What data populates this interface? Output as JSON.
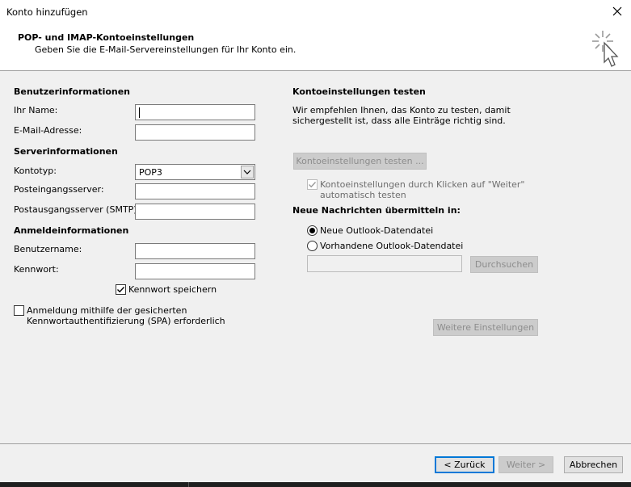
{
  "window": {
    "title": "Konto hinzufügen",
    "close_icon": "close-icon"
  },
  "header": {
    "title": "POP- und IMAP-Kontoeinstellungen",
    "subtitle": "Geben Sie die E-Mail-Servereinstellungen für Ihr Konto ein.",
    "icon": "sparkle-cursor-icon"
  },
  "left": {
    "user_section": "Benutzerinformationen",
    "name_label": "Ihr Name:",
    "name_value": "",
    "email_label": "E-Mail-Adresse:",
    "email_value": "",
    "server_section": "Serverinformationen",
    "account_type_label": "Kontotyp:",
    "account_type_value": "POP3",
    "incoming_label": "Posteingangsserver:",
    "incoming_value": "",
    "outgoing_label": "Postausgangsserver (SMTP):",
    "outgoing_value": "",
    "login_section": "Anmeldeinformationen",
    "username_label": "Benutzername:",
    "username_value": "",
    "password_label": "Kennwort:",
    "password_value": "",
    "save_password_label": "Kennwort speichern",
    "save_password_checked": true,
    "spa_label_line1": "Anmeldung mithilfe der gesicherten",
    "spa_label_line2": "Kennwortauthentifizierung (SPA) erforderlich",
    "spa_checked": false
  },
  "right": {
    "test_section": "Kontoeinstellungen testen",
    "test_desc_line1": "Wir empfehlen Ihnen, das Konto zu testen, damit",
    "test_desc_line2": "sichergestellt ist, dass alle Einträge richtig sind.",
    "test_button": "Kontoeinstellungen testen ...",
    "auto_test_line1": "Kontoeinstellungen durch Klicken auf \"Weiter\"",
    "auto_test_line2": "automatisch testen",
    "auto_test_checked": true,
    "deliver_section": "Neue Nachrichten übermitteln in:",
    "radio_new": "Neue Outlook-Datendatei",
    "radio_existing": "Vorhandene Outlook-Datendatei",
    "selected_radio": "new",
    "existing_path_value": "",
    "browse_button": "Durchsuchen",
    "more_settings_button": "Weitere Einstellungen"
  },
  "footer": {
    "back_button": "< Zurück",
    "next_button": "Weiter >",
    "cancel_button": "Abbrechen"
  },
  "colors": {
    "dialog_bg": "#f0f0f0",
    "focus_accent": "#0078d7"
  }
}
